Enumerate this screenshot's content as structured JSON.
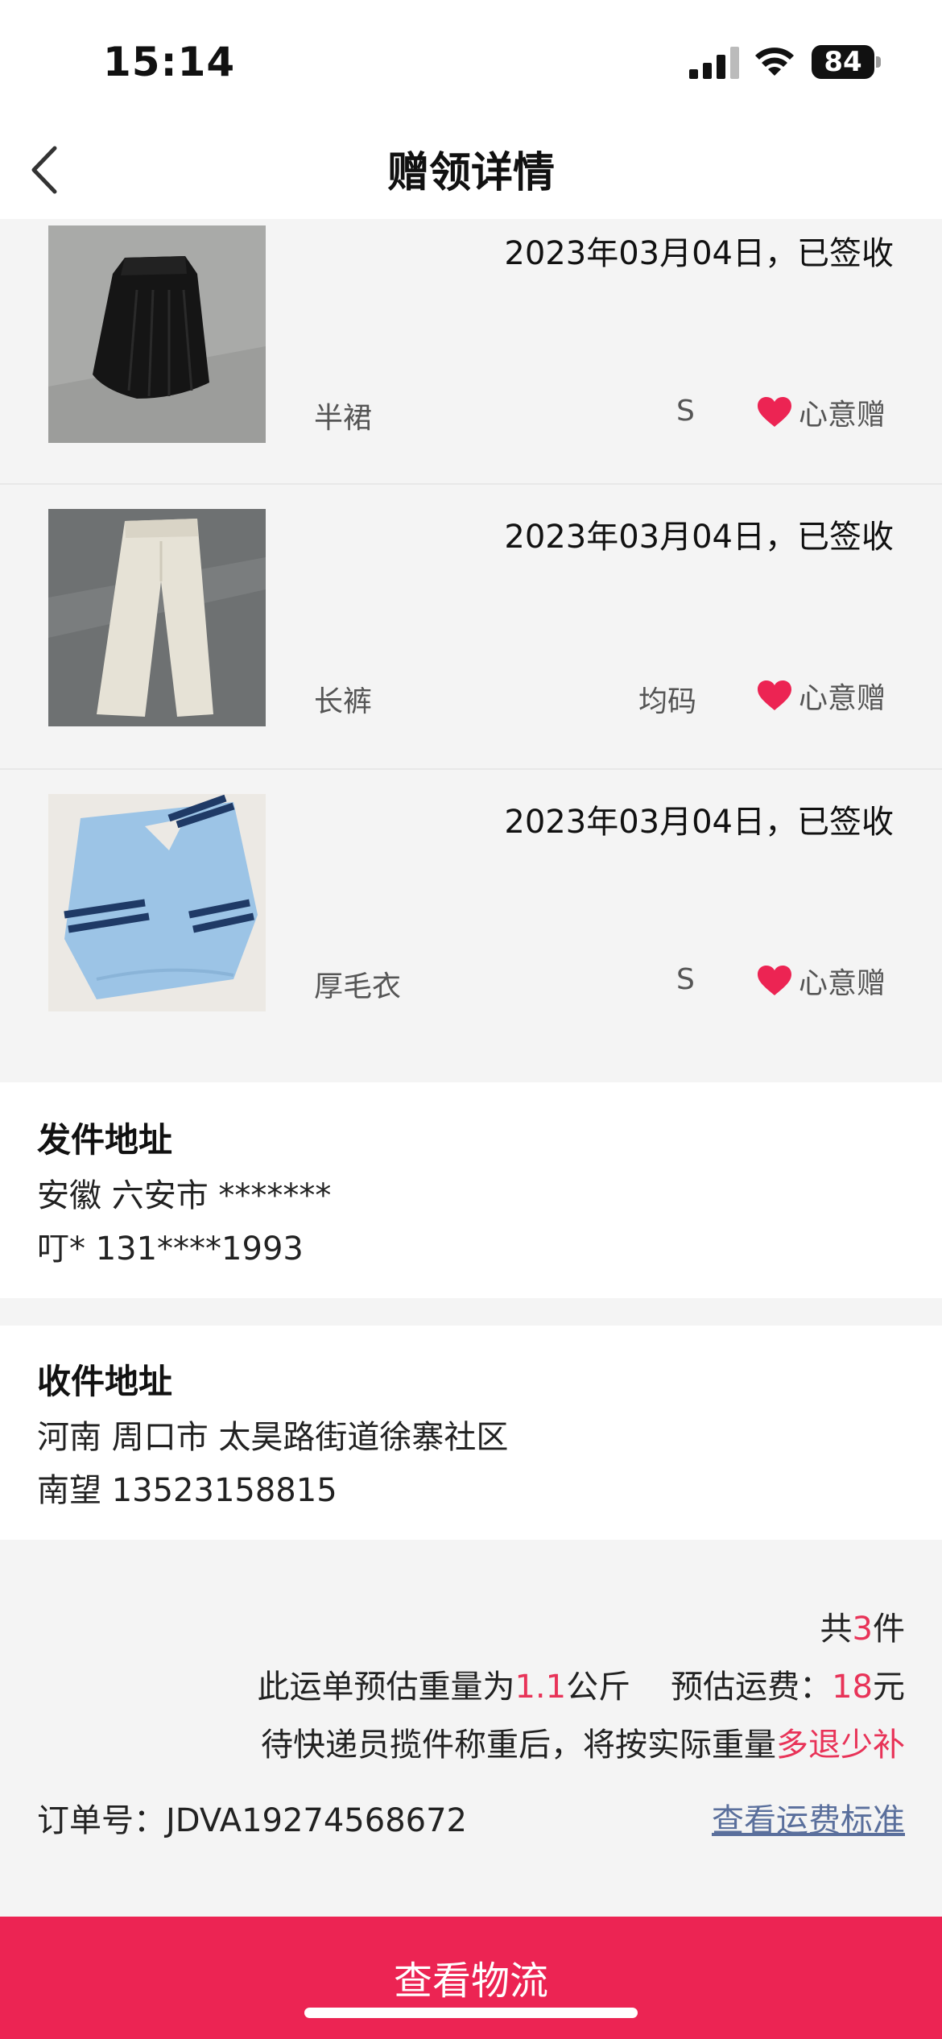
{
  "status": {
    "time": "15:14",
    "battery": "84"
  },
  "nav": {
    "title": "赠领详情"
  },
  "items": [
    {
      "date": "2023年03月04日，已签收",
      "name": "半裙",
      "size": "S",
      "gift_label": "心意赠"
    },
    {
      "date": "2023年03月04日，已签收",
      "name": "长裤",
      "size": "均码",
      "gift_label": "心意赠"
    },
    {
      "date": "2023年03月04日，已签收",
      "name": "厚毛衣",
      "size": "S",
      "gift_label": "心意赠"
    }
  ],
  "sender": {
    "title": "发件地址",
    "address": "安徽 六安市 *******",
    "contact": "叮* 131****1993"
  },
  "receiver": {
    "title": "收件地址",
    "address": "河南 周口市 太昊路街道徐寨社区",
    "contact": "南望 13523158815"
  },
  "summary": {
    "count_prefix": "共",
    "count": "3",
    "count_suffix": "件",
    "weight_prefix": "此运单预估重量为",
    "weight": "1.1",
    "weight_unit": "公斤",
    "fee_prefix": "预估运费：",
    "fee": "18",
    "fee_unit": "元",
    "note_prefix": "待快递员揽件称重后，将按实际重量",
    "note_highlight": "多退少补",
    "order_label": "订单号：",
    "order_no": "JDVA19274568672",
    "fee_link": "查看运费标准"
  },
  "bottom": {
    "button_label": "查看物流"
  },
  "colors": {
    "accent": "#ec2453",
    "highlight": "#e83358",
    "link": "#5a6f9c"
  }
}
